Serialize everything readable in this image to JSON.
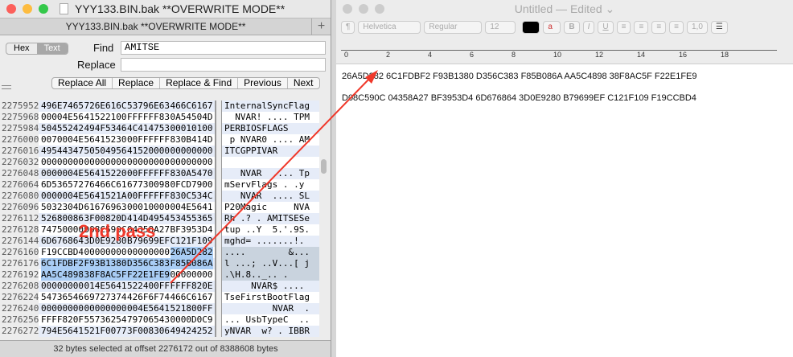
{
  "hex_window": {
    "title": "YYY133.BIN.bak **OVERWRITE MODE**",
    "tab_title": "YYY133.BIN.bak **OVERWRITE MODE**",
    "new_tab": "+",
    "mode_hex": "Hex",
    "mode_text": "Text",
    "find_label": "Find",
    "find_value": "AMITSE",
    "replace_label": "Replace",
    "replace_value": "",
    "buttons": [
      "Replace All",
      "Replace",
      "Replace & Find",
      "Previous",
      "Next"
    ],
    "rows": [
      {
        "off": "2275952",
        "hex": [
          "496E7465",
          "726E616C",
          "53796E63",
          "466C6167"
        ],
        "asc": "InternalSyncFlag"
      },
      {
        "off": "2275968",
        "hex": [
          "00004E56",
          "41522100",
          "FFFFFF83",
          "0A54504D"
        ],
        "asc": "  NVAR! .... TPM"
      },
      {
        "off": "2275984",
        "hex": [
          "50455242",
          "494F5346",
          "4C414753",
          "00010100"
        ],
        "asc": "PERBIOSFLAGS"
      },
      {
        "off": "2276000",
        "hex": [
          "0070004E",
          "56415230",
          "00FFFFFF",
          "830B414D"
        ],
        "asc": " p NVAR0 .... AM"
      },
      {
        "off": "2276016",
        "hex": [
          "49544347",
          "50504956",
          "41520000",
          "00000000"
        ],
        "asc": "ITCGPPIVAR"
      },
      {
        "off": "2276032",
        "hex": [
          "00000000",
          "00000000",
          "00000000",
          "00000000"
        ],
        "asc": ""
      },
      {
        "off": "2276048",
        "hex": [
          "0000004E",
          "56415220",
          "00FFFFFF",
          "830A5470"
        ],
        "asc": "   NVAR  .... Tp"
      },
      {
        "off": "2276064",
        "hex": [
          "6D536572",
          "76466C61",
          "67730098",
          "0FCD7900"
        ],
        "asc": "mServFlags . .y"
      },
      {
        "off": "2276080",
        "hex": [
          "0000004E",
          "5641521A",
          "00FFFFFF",
          "830C534C"
        ],
        "asc": "   NVAR  .... SL"
      },
      {
        "off": "2276096",
        "hex": [
          "5032304D",
          "61676963",
          "00010000",
          "004E5641"
        ],
        "asc": "P20Magic     NVA"
      },
      {
        "off": "2276112",
        "hex": [
          "52680086",
          "3F00820D",
          "414D4954",
          "53455365"
        ],
        "asc": "Rh .? . AMITSESe"
      },
      {
        "off": "2276128",
        "hex": [
          "74750000",
          "D08C590C",
          "04358A27",
          "BF3953D4"
        ],
        "asc": "tup ..Y  5.'.9S."
      },
      {
        "off": "2276144",
        "hex": [
          "6D676864",
          "3D0E9280",
          "B79699EF",
          "C121F109"
        ],
        "asc": "mghd= .......!."
      },
      {
        "off": "2276160",
        "hex": [
          "F19CCBD4",
          "00000000",
          "00000000",
          "26A5D282"
        ],
        "asc": "....        &..."
      },
      {
        "off": "2276176",
        "hex": [
          "6C1FDBF2",
          "F93B1380",
          "D356C383",
          "F85B086A"
        ],
        "asc": "l ...; ..V...[ j"
      },
      {
        "off": "2276192",
        "hex": [
          "AA5C4898",
          "38F8AC5F",
          "F22E1FE9",
          "00000000"
        ],
        "asc": ".\\H.8.._.. ."
      },
      {
        "off": "2276208",
        "hex": [
          "00000000",
          "014E5641",
          "522400FF",
          "FFFF820E"
        ],
        "asc": "     NVAR$ ...."
      },
      {
        "off": "2276224",
        "hex": [
          "54736546",
          "69727374",
          "426F6F74",
          "466C6167"
        ],
        "asc": "TseFirstBootFlag"
      },
      {
        "off": "2276240",
        "hex": [
          "00000000",
          "00000000",
          "004E5641",
          "521800FF"
        ],
        "asc": "         NVAR  ."
      },
      {
        "off": "2276256",
        "hex": [
          "FFFF820F",
          "55736254",
          "79706543",
          "0000D0C9"
        ],
        "asc": "... UsbTypeC  .."
      },
      {
        "off": "2276272",
        "hex": [
          "794E5641",
          "521F0077",
          "3F008306",
          "49424252"
        ],
        "asc": "yNVAR  w? . IBBR"
      }
    ],
    "status": "32 bytes selected at offset 2276172 out of 8388608 bytes"
  },
  "annotation": {
    "label": "2nd pass",
    "color": "#f0382a"
  },
  "textedit": {
    "title": "Untitled — Edited",
    "toolbar": {
      "paragraph": "¶",
      "font": "Helvetica",
      "style": "Regular",
      "size": "12",
      "bold": "B",
      "italic": "I",
      "underline": "U",
      "spacing": "1,0"
    },
    "ruler_numbers": [
      "0",
      "2",
      "4",
      "6",
      "8",
      "10",
      "12",
      "14",
      "16",
      "18"
    ],
    "lines": [
      "26A5D282 6C1FDBF2 F93B1380 D356C383 F85B086A AA5C4898 38F8AC5F F22E1FE9",
      "D08C590C 04358A27 BF3953D4 6D676864 3D0E9280 B79699EF C121F109 F19CCBD4"
    ]
  }
}
